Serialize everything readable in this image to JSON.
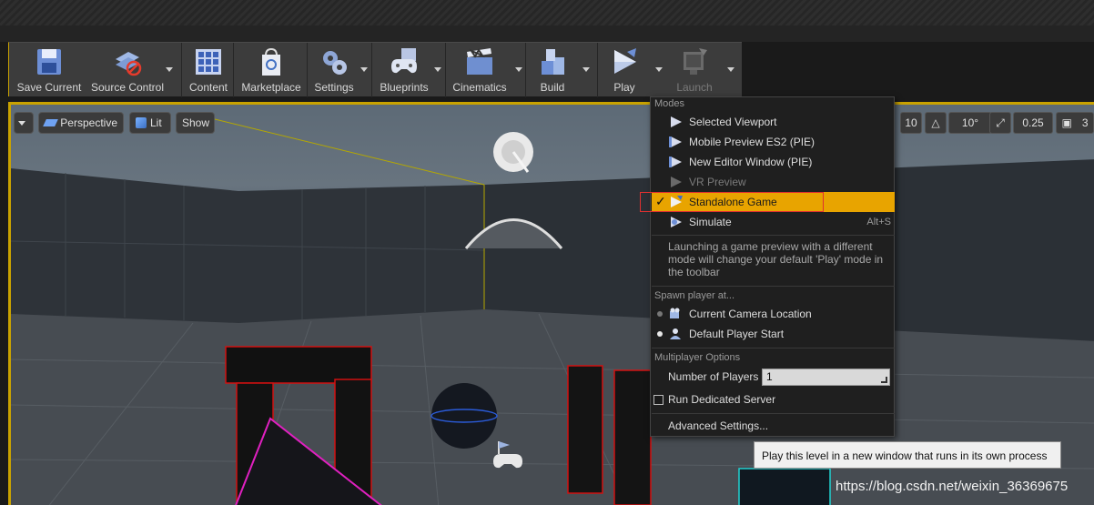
{
  "toolbar": {
    "save_current": "Save Current",
    "source_control": "Source Control",
    "content": "Content",
    "marketplace": "Marketplace",
    "settings": "Settings",
    "blueprints": "Blueprints",
    "cinematics": "Cinematics",
    "build": "Build",
    "play": "Play",
    "launch": "Launch"
  },
  "viewport": {
    "perspective": "Perspective",
    "lit": "Lit",
    "show": "Show",
    "grid_snap": "10",
    "rotation_snap": "10°",
    "scale_snap": "0.25",
    "camera_speed": "3"
  },
  "play_menu": {
    "modes_header": "Modes",
    "modes": [
      {
        "label": "Selected Viewport",
        "icon": "play-icon"
      },
      {
        "label": "Mobile Preview ES2 (PIE)",
        "icon": "play-icon"
      },
      {
        "label": "New Editor Window (PIE)",
        "icon": "play-icon"
      },
      {
        "label": "VR Preview",
        "icon": "play-icon"
      },
      {
        "label": "Standalone Game",
        "icon": "play-icon"
      },
      {
        "label": "Simulate",
        "icon": "simulate-icon",
        "shortcut": "Alt+S"
      }
    ],
    "hint": "Launching a game preview with a different mode will change your default 'Play' mode in the toolbar",
    "spawn_header": "Spawn player at...",
    "spawn_options": [
      {
        "label": "Current Camera Location"
      },
      {
        "label": "Default Player Start"
      }
    ],
    "multiplayer_header": "Multiplayer Options",
    "num_players_label": "Number of Players",
    "num_players_value": "1",
    "dedicated_server_label": "Run Dedicated Server",
    "advanced_settings": "Advanced Settings..."
  },
  "tooltip": "Play this level in a new window that runs in its own process",
  "watermark": "https://blog.csdn.net/weixin_36369675",
  "colors": {
    "selected_item": "#e8a400",
    "viewport_border": "#c9a200",
    "highlight_box": "#e03030"
  }
}
